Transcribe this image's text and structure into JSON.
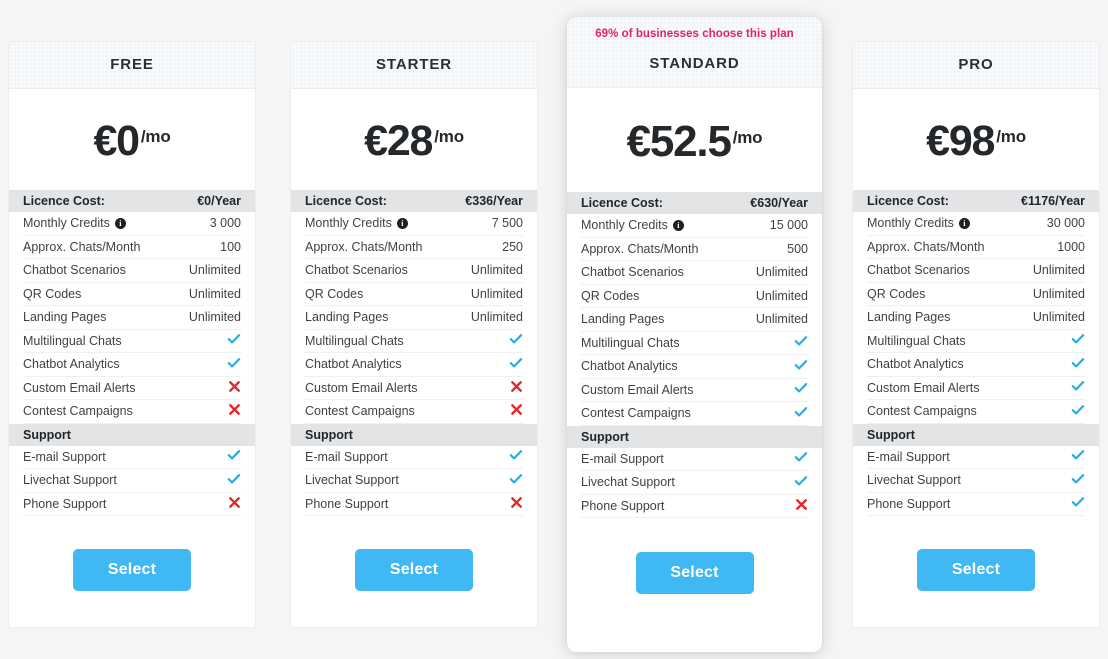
{
  "colors": {
    "accent_button": "#3fb8f4",
    "badge_text": "#e61e64",
    "check": "#29ade4",
    "cross": "#e12727",
    "page_background": "#f5f5f6",
    "section_band": "#e3e4e5",
    "header_band": "#f8f9fb"
  },
  "icons": {
    "info": "i",
    "check": "check-icon",
    "cross": "cross-icon"
  },
  "plans": [
    {
      "name": "FREE",
      "badge": "",
      "highlighted": false,
      "price_amount": "€0",
      "price_period": "/mo",
      "select_label": "Select",
      "rows": [
        {
          "type": "section",
          "label": "Licence Cost:",
          "value": "€0/Year"
        },
        {
          "type": "text",
          "label": "Monthly Credits",
          "info": true,
          "value": "3 000"
        },
        {
          "type": "text",
          "label": "Approx. Chats/Month",
          "info": false,
          "value": "100"
        },
        {
          "type": "text",
          "label": "Chatbot Scenarios",
          "info": false,
          "value": "Unlimited"
        },
        {
          "type": "text",
          "label": "QR Codes",
          "info": false,
          "value": "Unlimited"
        },
        {
          "type": "text",
          "label": "Landing Pages",
          "info": false,
          "value": "Unlimited"
        },
        {
          "type": "check",
          "label": "Multilingual Chats",
          "info": false,
          "value": "yes"
        },
        {
          "type": "check",
          "label": "Chatbot Analytics",
          "info": false,
          "value": "yes"
        },
        {
          "type": "check",
          "label": "Custom Email Alerts",
          "info": false,
          "value": "no"
        },
        {
          "type": "check",
          "label": "Contest Campaigns",
          "info": false,
          "value": "no"
        },
        {
          "type": "section",
          "label": "Support",
          "value": ""
        },
        {
          "type": "check",
          "label": "E-mail Support",
          "info": false,
          "value": "yes"
        },
        {
          "type": "check",
          "label": "Livechat Support",
          "info": false,
          "value": "yes"
        },
        {
          "type": "check",
          "label": "Phone Support",
          "info": false,
          "value": "no"
        }
      ]
    },
    {
      "name": "STARTER",
      "badge": "",
      "highlighted": false,
      "price_amount": "€28",
      "price_period": "/mo",
      "select_label": "Select",
      "rows": [
        {
          "type": "section",
          "label": "Licence Cost:",
          "value": "€336/Year"
        },
        {
          "type": "text",
          "label": "Monthly Credits",
          "info": true,
          "value": "7 500"
        },
        {
          "type": "text",
          "label": "Approx. Chats/Month",
          "info": false,
          "value": "250"
        },
        {
          "type": "text",
          "label": "Chatbot Scenarios",
          "info": false,
          "value": "Unlimited"
        },
        {
          "type": "text",
          "label": "QR Codes",
          "info": false,
          "value": "Unlimited"
        },
        {
          "type": "text",
          "label": "Landing Pages",
          "info": false,
          "value": "Unlimited"
        },
        {
          "type": "check",
          "label": "Multilingual Chats",
          "info": false,
          "value": "yes"
        },
        {
          "type": "check",
          "label": "Chatbot Analytics",
          "info": false,
          "value": "yes"
        },
        {
          "type": "check",
          "label": "Custom Email Alerts",
          "info": false,
          "value": "no"
        },
        {
          "type": "check",
          "label": "Contest Campaigns",
          "info": false,
          "value": "no"
        },
        {
          "type": "section",
          "label": "Support",
          "value": ""
        },
        {
          "type": "check",
          "label": "E-mail Support",
          "info": false,
          "value": "yes"
        },
        {
          "type": "check",
          "label": "Livechat Support",
          "info": false,
          "value": "yes"
        },
        {
          "type": "check",
          "label": "Phone Support",
          "info": false,
          "value": "no"
        }
      ]
    },
    {
      "name": "STANDARD",
      "badge": "69% of businesses choose this plan",
      "highlighted": true,
      "price_amount": "€52.5",
      "price_period": "/mo",
      "select_label": "Select",
      "rows": [
        {
          "type": "section",
          "label": "Licence Cost:",
          "value": "€630/Year"
        },
        {
          "type": "text",
          "label": "Monthly Credits",
          "info": true,
          "value": "15 000"
        },
        {
          "type": "text",
          "label": "Approx. Chats/Month",
          "info": false,
          "value": "500"
        },
        {
          "type": "text",
          "label": "Chatbot Scenarios",
          "info": false,
          "value": "Unlimited"
        },
        {
          "type": "text",
          "label": "QR Codes",
          "info": false,
          "value": "Unlimited"
        },
        {
          "type": "text",
          "label": "Landing Pages",
          "info": false,
          "value": "Unlimited"
        },
        {
          "type": "check",
          "label": "Multilingual Chats",
          "info": false,
          "value": "yes"
        },
        {
          "type": "check",
          "label": "Chatbot Analytics",
          "info": false,
          "value": "yes"
        },
        {
          "type": "check",
          "label": "Custom Email Alerts",
          "info": false,
          "value": "yes"
        },
        {
          "type": "check",
          "label": "Contest Campaigns",
          "info": false,
          "value": "yes"
        },
        {
          "type": "section",
          "label": "Support",
          "value": ""
        },
        {
          "type": "check",
          "label": "E-mail Support",
          "info": false,
          "value": "yes"
        },
        {
          "type": "check",
          "label": "Livechat Support",
          "info": false,
          "value": "yes"
        },
        {
          "type": "check",
          "label": "Phone Support",
          "info": false,
          "value": "no"
        }
      ]
    },
    {
      "name": "PRO",
      "badge": "",
      "highlighted": false,
      "price_amount": "€98",
      "price_period": "/mo",
      "select_label": "Select",
      "rows": [
        {
          "type": "section",
          "label": "Licence Cost:",
          "value": "€1176/Year"
        },
        {
          "type": "text",
          "label": "Monthly Credits",
          "info": true,
          "value": "30 000"
        },
        {
          "type": "text",
          "label": "Approx. Chats/Month",
          "info": false,
          "value": "1000"
        },
        {
          "type": "text",
          "label": "Chatbot Scenarios",
          "info": false,
          "value": "Unlimited"
        },
        {
          "type": "text",
          "label": "QR Codes",
          "info": false,
          "value": "Unlimited"
        },
        {
          "type": "text",
          "label": "Landing Pages",
          "info": false,
          "value": "Unlimited"
        },
        {
          "type": "check",
          "label": "Multilingual Chats",
          "info": false,
          "value": "yes"
        },
        {
          "type": "check",
          "label": "Chatbot Analytics",
          "info": false,
          "value": "yes"
        },
        {
          "type": "check",
          "label": "Custom Email Alerts",
          "info": false,
          "value": "yes"
        },
        {
          "type": "check",
          "label": "Contest Campaigns",
          "info": false,
          "value": "yes"
        },
        {
          "type": "section",
          "label": "Support",
          "value": ""
        },
        {
          "type": "check",
          "label": "E-mail Support",
          "info": false,
          "value": "yes"
        },
        {
          "type": "check",
          "label": "Livechat Support",
          "info": false,
          "value": "yes"
        },
        {
          "type": "check",
          "label": "Phone Support",
          "info": false,
          "value": "yes"
        }
      ]
    }
  ]
}
